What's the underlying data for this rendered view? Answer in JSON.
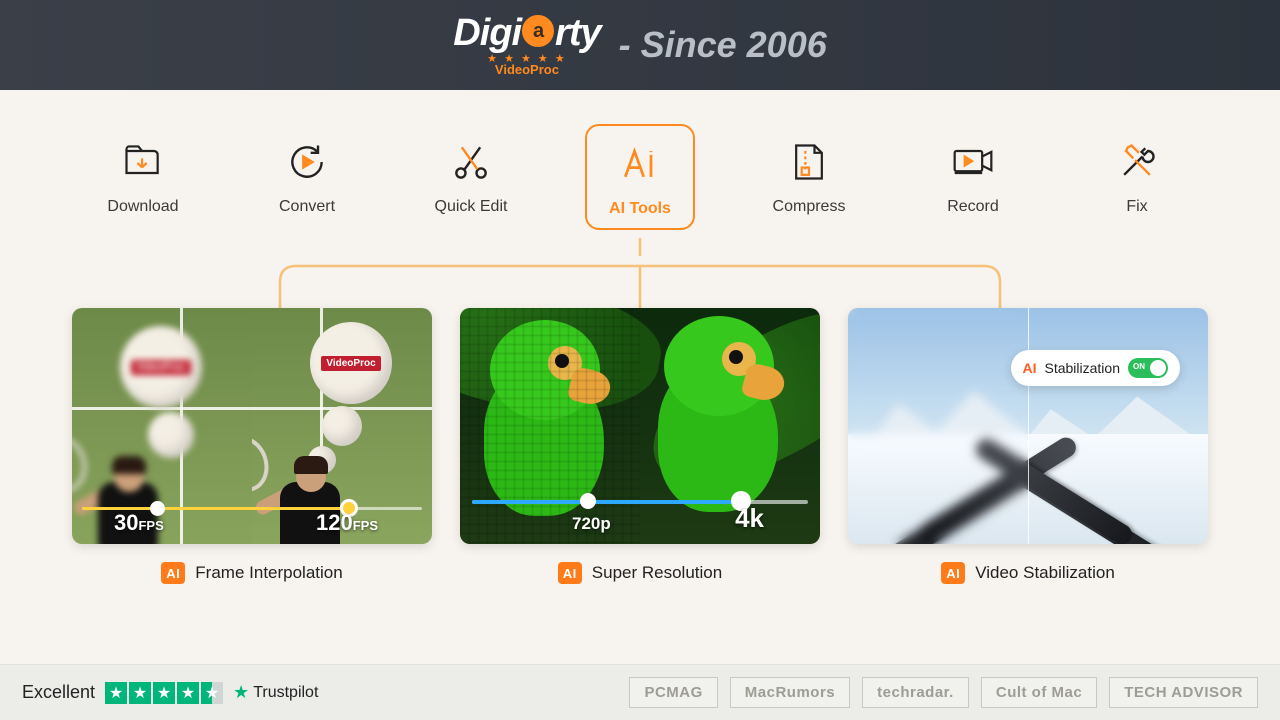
{
  "header": {
    "brand_prefix": "Digi",
    "brand_letter": "a",
    "brand_suffix": "rty",
    "brand_sub": "VideoProc",
    "since": "- Since 2006"
  },
  "tabs": [
    {
      "id": "download",
      "label": "Download"
    },
    {
      "id": "convert",
      "label": "Convert"
    },
    {
      "id": "quickedit",
      "label": "Quick Edit"
    },
    {
      "id": "aitools",
      "label": "AI Tools",
      "active": true
    },
    {
      "id": "compress",
      "label": "Compress"
    },
    {
      "id": "record",
      "label": "Record"
    },
    {
      "id": "fix",
      "label": "Fix"
    }
  ],
  "ai_badge": "AI",
  "features": {
    "interpolation": {
      "label": "Frame Interpolation",
      "low_fps": "30",
      "low_unit": "FPS",
      "high_fps": "120",
      "high_unit": "FPS",
      "ball_tag": "VideoProc"
    },
    "super_resolution": {
      "label": "Super Resolution",
      "low_res": "720p",
      "high_res": "4k"
    },
    "stabilization": {
      "label": "Video Stabilization",
      "chip_ai": "AI",
      "chip_text": "Stabilization",
      "toggle_text": "ON"
    }
  },
  "footer": {
    "rating_word": "Excellent",
    "trustpilot": "Trustpilot",
    "press": [
      "PCMAG",
      "MacRumors",
      "techradar.",
      "Cult of Mac",
      "TECH ADVISOR"
    ]
  }
}
